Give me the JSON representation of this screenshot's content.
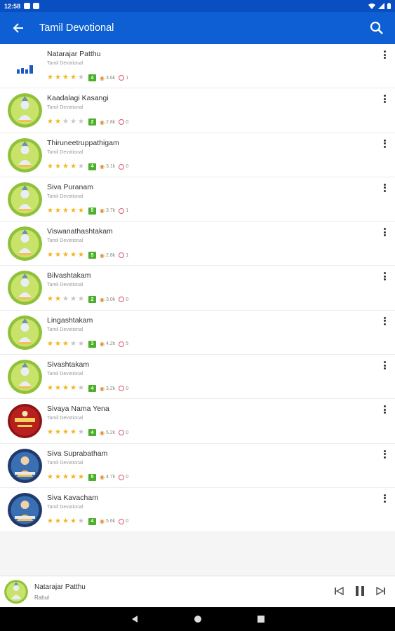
{
  "status_bar": {
    "time": "12:58"
  },
  "app_bar": {
    "title": "Tamil Devotional",
    "icons": [
      "back-arrow-icon",
      "search-icon"
    ]
  },
  "songs": [
    {
      "title": "Natarajar Patthu",
      "artist": "Tamil Devotional",
      "rating": 4,
      "rating_label": "4",
      "views": "3.6k",
      "likes": "1",
      "thumb": "equalizer"
    },
    {
      "title": "Kaadalagi Kasangi",
      "artist": "Tamil Devotional",
      "rating": 2,
      "rating_label": "2",
      "views": "2.8k",
      "likes": "0",
      "thumb": "shiva-green"
    },
    {
      "title": "Thiruneetruppathigam",
      "artist": "Tamil Devotional",
      "rating": 4,
      "rating_label": "4",
      "views": "3.1k",
      "likes": "0",
      "thumb": "shiva-green"
    },
    {
      "title": "Siva Puranam",
      "artist": "Tamil Devotional",
      "rating": 5,
      "rating_label": "5",
      "views": "3.7k",
      "likes": "1",
      "thumb": "shiva-green"
    },
    {
      "title": "Viswanathashtakam",
      "artist": "Tamil Devotional",
      "rating": 5,
      "rating_label": "5",
      "views": "2.8k",
      "likes": "1",
      "thumb": "shiva-green"
    },
    {
      "title": "Bilvashtakam",
      "artist": "Tamil Devotional",
      "rating": 2,
      "rating_label": "2",
      "views": "3.0k",
      "likes": "0",
      "thumb": "shiva-green"
    },
    {
      "title": "Lingashtakam",
      "artist": "Tamil Devotional",
      "rating": 3,
      "rating_label": "3",
      "views": "4.2k",
      "likes": "5",
      "thumb": "shiva-green"
    },
    {
      "title": "Sivashtakam",
      "artist": "Tamil Devotional",
      "rating": 4,
      "rating_label": "4",
      "views": "3.2k",
      "likes": "0",
      "thumb": "shiva-green"
    },
    {
      "title": "Sivaya Nama Yena",
      "artist": "Tamil Devotional",
      "rating": 4,
      "rating_label": "4",
      "views": "5.2k",
      "likes": "0",
      "thumb": "red-album"
    },
    {
      "title": "Siva Suprabatham",
      "artist": "Tamil Devotional",
      "rating": 5,
      "rating_label": "5",
      "views": "4.7k",
      "likes": "0",
      "thumb": "blue-album"
    },
    {
      "title": "Siva Kavacham",
      "artist": "Tamil Devotional",
      "rating": 4,
      "rating_label": "4",
      "views": "5.6k",
      "likes": "0",
      "thumb": "blue-album"
    }
  ],
  "now_playing": {
    "title": "Natarajar Patthu",
    "artist": "Rahul"
  },
  "colors": {
    "app_bar": "#0d5fd3",
    "status_bar": "#0a4fc2",
    "star": "#f2b51c",
    "rating_badge": "#4caf2c"
  }
}
